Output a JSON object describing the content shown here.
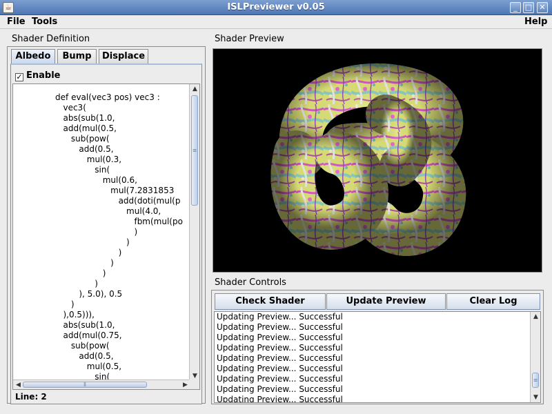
{
  "window": {
    "title": "ISLPreviewer v0.05"
  },
  "menu": {
    "left": [
      "File",
      "Tools"
    ],
    "right": "Help"
  },
  "shader_definition": {
    "label": "Shader Definition",
    "tabs": [
      "Albedo",
      "Bump",
      "Displace"
    ],
    "active_tab": "Albedo",
    "enable_label": "Enable",
    "enable_checked": true,
    "code_lines": [
      "                def eval(vec3 pos) vec3 :",
      "                   vec3(",
      "                   abs(sub(1.0,",
      "                   add(mul(0.5,",
      "                      sub(pow(",
      "                         add(0.5,",
      "                            mul(0.3,",
      "                               sin(",
      "                                  mul(0.6,",
      "                                     mul(7.2831853",
      "                                        add(doti(mul(p",
      "                                           mul(4.0,",
      "                                              fbm(mul(po",
      "                                              )",
      "                                           )",
      "                                        )",
      "                                     )",
      "                                  )",
      "                               )",
      "                         ), 5.0), 0.5",
      "                      )",
      "                   ),0.5))),",
      "                   abs(sub(1.0,",
      "                   add(mul(0.75,",
      "                      sub(pow(",
      "                         add(0.5,",
      "                            mul(0.5,",
      "                               sin("
    ],
    "status": "Line: 2"
  },
  "shader_preview": {
    "label": "Shader Preview"
  },
  "shader_controls": {
    "label": "Shader Controls",
    "buttons": {
      "check": "Check Shader",
      "update": "Update Preview",
      "clear": "Clear Log"
    },
    "log": [
      "Updating Preview... Successful",
      "Updating Preview... Successful",
      "Updating Preview... Successful",
      "Updating Preview... Successful",
      "Updating Preview... Successful",
      "Updating Preview... Successful",
      "Updating Preview... Successful",
      "Updating Preview... Successful",
      "Updating Preview... Successful"
    ]
  },
  "colors": {
    "title_bar": "#5b80b9",
    "preview_background": "#000000",
    "torus_pink": "#d85ac8",
    "torus_yellow": "#dfe36a",
    "torus_teal": "#8fd0c4",
    "torus_white": "#eef0e6"
  }
}
